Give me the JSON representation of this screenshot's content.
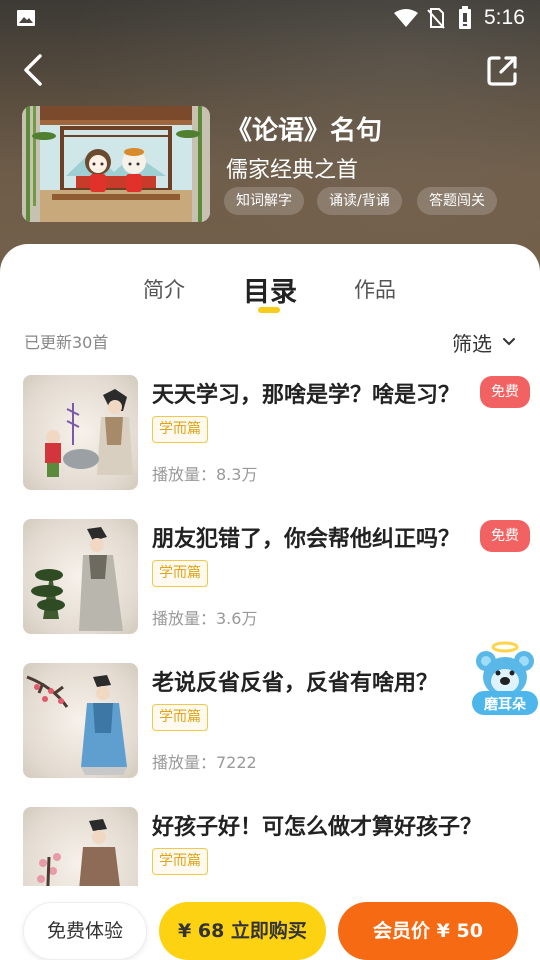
{
  "status_bar": {
    "time": "5:16",
    "icons": [
      "photo-icon",
      "wifi-icon",
      "no-sim-icon",
      "battery-icon"
    ]
  },
  "nav": {
    "back_icon": "chevron-left-icon",
    "share_icon": "share-external-icon"
  },
  "album": {
    "title": "《论语》名句",
    "subtitle": "儒家经典之首",
    "tags": [
      "知词解字",
      "诵读/背诵",
      "答题闯关"
    ]
  },
  "tabs": [
    {
      "label": "简介",
      "active": false
    },
    {
      "label": "目录",
      "active": true
    },
    {
      "label": "作品",
      "active": false
    }
  ],
  "list_header": {
    "updated_text": "已更新30首",
    "filter_label": "筛选"
  },
  "items": [
    {
      "title": "天天学习，那啥是学？啥是习？",
      "tag": "学而篇",
      "plays": "播放量：8.3万",
      "badge": "免费"
    },
    {
      "title": "朋友犯错了，你会帮他纠正吗？",
      "tag": "学而篇",
      "plays": "播放量：3.6万",
      "badge": "免费"
    },
    {
      "title": "老说反省反省，反省有啥用？",
      "tag": "学而篇",
      "plays": "播放量：7222",
      "badge": ""
    },
    {
      "title": "好孩子好！可怎么做才算好孩子？",
      "tag": "学而篇",
      "plays": "",
      "badge": ""
    }
  ],
  "mascot": {
    "label": "磨耳朵"
  },
  "bottom_bar": {
    "free_trial": "免费体验",
    "buy": "¥ 68 立即购买",
    "member": "会员价 ¥ 50"
  },
  "colors": {
    "accent_yellow": "#fcd212",
    "accent_orange": "#f56a12",
    "free_badge": "#f36262",
    "tag_border": "#f0c84a"
  }
}
